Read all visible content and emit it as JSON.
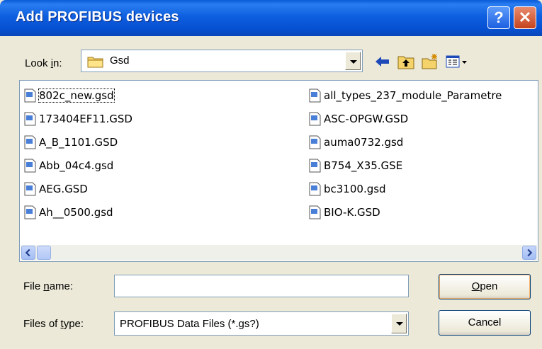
{
  "window": {
    "title": "Add PROFIBUS devices"
  },
  "titlebar_buttons": {
    "help": "?",
    "close": "✕"
  },
  "lookin": {
    "label_pre": "Look ",
    "label_key": "i",
    "label_post": "n:",
    "value": "Gsd"
  },
  "toolbar": [
    "back-arrow-icon",
    "up-folder-icon",
    "new-folder-icon",
    "view-menu-icon"
  ],
  "files": {
    "column1": [
      "802c_new.gsd",
      "173404EF11.GSD",
      "A_B_1101.GSD",
      "Abb_04c4.gsd",
      "AEG.GSD",
      "Ah__0500.gsd"
    ],
    "column2": [
      "all_types_237_module_Parametre",
      "ASC-OPGW.GSD",
      "auma0732.gsd",
      "B754_X35.GSE",
      "bc3100.gsd",
      "BIO-K.GSD"
    ]
  },
  "filename": {
    "label_pre": "File ",
    "label_key": "n",
    "label_post": "ame:",
    "value": ""
  },
  "filetype": {
    "label_pre": "Files of ",
    "label_key": "t",
    "label_post": "ype:",
    "value": "PROFIBUS Data Files (*.gs?)"
  },
  "buttons": {
    "open_key": "O",
    "open_rest": "pen",
    "cancel": "Cancel"
  }
}
